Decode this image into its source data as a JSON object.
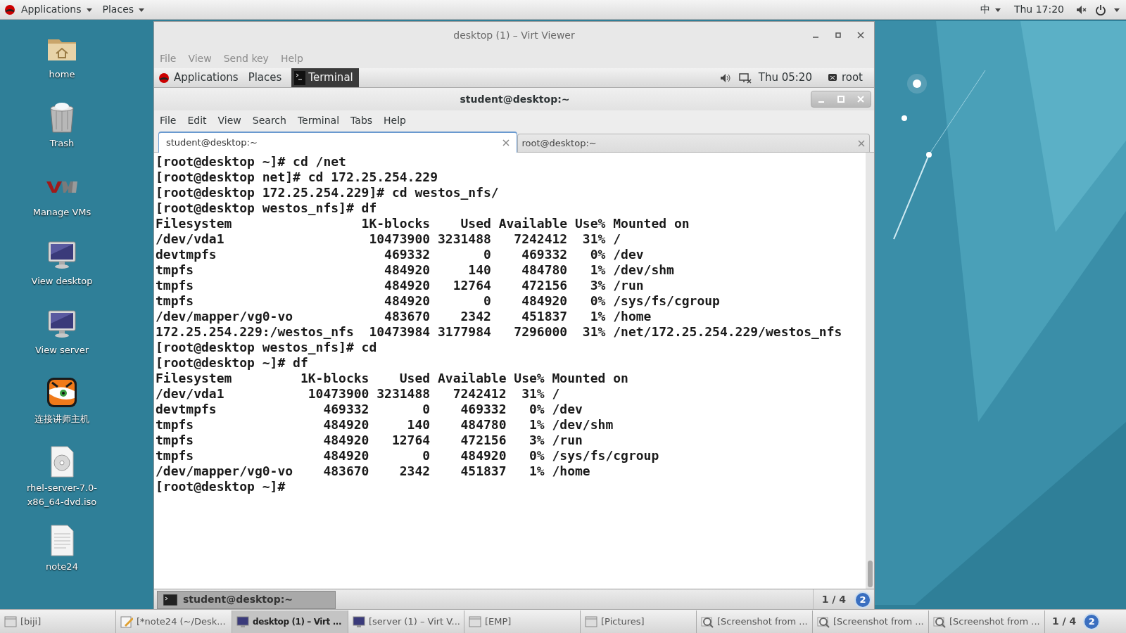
{
  "top_bar": {
    "menus": [
      "Applications",
      "Places"
    ],
    "input_method": "中",
    "clock": "Thu 17:20"
  },
  "desktop_icons": [
    {
      "label": "home",
      "kind": "folder"
    },
    {
      "label": "Trash",
      "kind": "trash"
    },
    {
      "label": "Manage VMs",
      "kind": "vm"
    },
    {
      "label": "View desktop",
      "kind": "monitor"
    },
    {
      "label": "View server",
      "kind": "monitor"
    },
    {
      "label": "连接讲师主机",
      "kind": "tiger"
    },
    {
      "label": "rhel-server-7.0-x86_64-dvd.iso",
      "kind": "disc"
    },
    {
      "label": "note24",
      "kind": "text"
    }
  ],
  "virt_viewer": {
    "title": "desktop (1) – Virt Viewer",
    "menu": [
      "File",
      "View",
      "Send key",
      "Help"
    ],
    "guest_top_bar": {
      "menus": [
        "Applications",
        "Places"
      ],
      "task": "Terminal",
      "clock": "Thu 05:20",
      "user": "root"
    },
    "terminal": {
      "title": "student@desktop:~",
      "menu": [
        "File",
        "Edit",
        "View",
        "Search",
        "Terminal",
        "Tabs",
        "Help"
      ],
      "tabs": [
        {
          "label": "student@desktop:~",
          "selected": true
        },
        {
          "label": "root@desktop:~",
          "selected": false
        }
      ],
      "lines": [
        "[root@desktop ~]# cd /net",
        "[root@desktop net]# cd 172.25.254.229",
        "[root@desktop 172.25.254.229]# cd westos_nfs/",
        "[root@desktop westos_nfs]# df",
        "Filesystem                 1K-blocks    Used Available Use% Mounted on",
        "/dev/vda1                   10473900 3231488   7242412  31% /",
        "devtmpfs                      469332       0    469332   0% /dev",
        "tmpfs                         484920     140    484780   1% /dev/shm",
        "tmpfs                         484920   12764    472156   3% /run",
        "tmpfs                         484920       0    484920   0% /sys/fs/cgroup",
        "/dev/mapper/vg0-vo            483670    2342    451837   1% /home",
        "172.25.254.229:/westos_nfs  10473984 3177984   7296000  31% /net/172.25.254.229/westos_nfs",
        "[root@desktop westos_nfs]# cd",
        "[root@desktop ~]# df",
        "Filesystem         1K-blocks    Used Available Use% Mounted on",
        "/dev/vda1           10473900 3231488   7242412  31% /",
        "devtmpfs              469332       0    469332   0% /dev",
        "tmpfs                 484920     140    484780   1% /dev/shm",
        "tmpfs                 484920   12764    472156   3% /run",
        "tmpfs                 484920       0    484920   0% /sys/fs/cgroup",
        "/dev/mapper/vg0-vo    483670    2342    451837   1% /home",
        "[root@desktop ~]#"
      ]
    },
    "guest_bottom_bar": {
      "task": "student@desktop:~",
      "workspace": "1 / 4",
      "notifications": "2"
    }
  },
  "taskbar": {
    "items": [
      {
        "label": "[biji]",
        "kind": "window",
        "selected": false
      },
      {
        "label": "[*note24 (~/Desk...",
        "kind": "editor",
        "selected": false
      },
      {
        "label": "desktop (1) – Virt ...",
        "kind": "viewer",
        "selected": true
      },
      {
        "label": "[server (1) – Virt V...",
        "kind": "viewer",
        "selected": false
      },
      {
        "label": "[EMP]",
        "kind": "window",
        "selected": false
      },
      {
        "label": "[Pictures]",
        "kind": "window",
        "selected": false
      },
      {
        "label": "[Screenshot from ...",
        "kind": "screenshot",
        "selected": false
      },
      {
        "label": "[Screenshot from ...",
        "kind": "screenshot",
        "selected": false
      },
      {
        "label": "[Screenshot from ...",
        "kind": "screenshot",
        "selected": false
      }
    ],
    "workspace": "1 / 4",
    "notifications": "2"
  }
}
